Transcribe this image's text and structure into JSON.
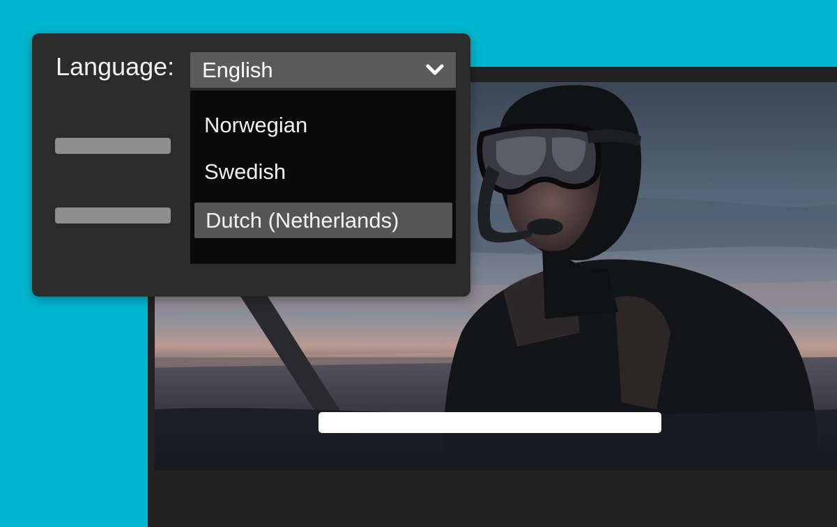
{
  "language_menu": {
    "label": "Language:",
    "selected_value": "English",
    "options": [
      {
        "label": "Norwegian",
        "highlighted": false
      },
      {
        "label": "Swedish",
        "highlighted": false
      },
      {
        "label": "Dutch (Netherlands)",
        "highlighted": true
      }
    ]
  },
  "icons": {
    "dropdown": "chevron-down-icon"
  },
  "colors": {
    "background": "#02b8d0",
    "panel": "#2b2b2b",
    "select_box": "#5b5b5b",
    "dropdown_list": "#0a0a0a",
    "highlighted_option": "#555555",
    "player_frame": "#222222",
    "caption_bar": "#ffffff"
  }
}
